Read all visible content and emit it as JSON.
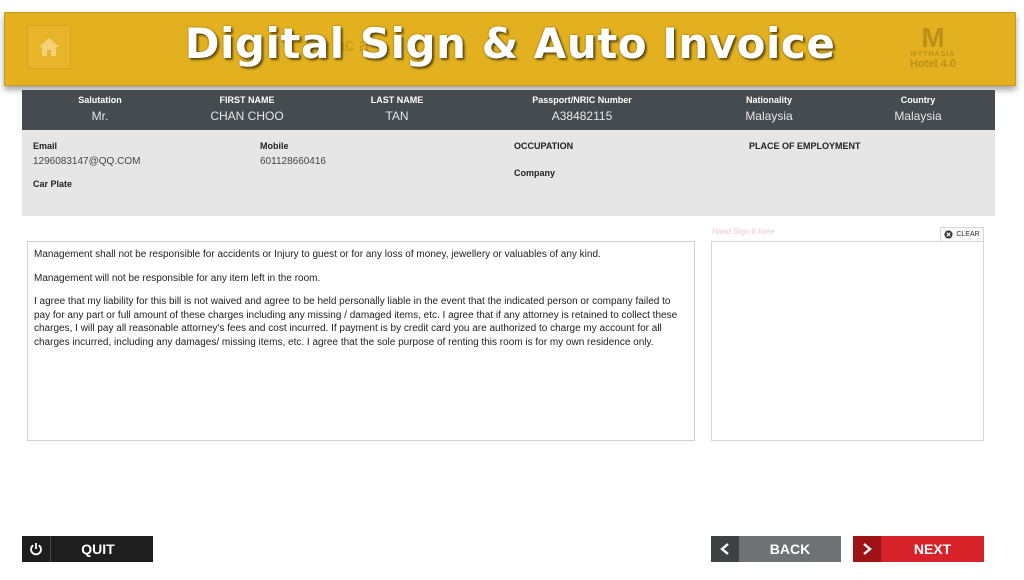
{
  "banner": {
    "title": "Digital Sign & Auto Invoice",
    "behind_text": "the      ac                     a",
    "logo_mark": "M",
    "logo_line1": "MYTHASIA",
    "logo_line2": "Hotel 4.0"
  },
  "guest": {
    "salutation_label": "Salutation",
    "salutation": "Mr.",
    "first_name_label": "FIRST NAME",
    "first_name": "CHAN CHOO",
    "last_name_label": "LAST NAME",
    "last_name": "TAN",
    "passport_label": "Passport/NRIC Number",
    "passport": "A38482115",
    "nationality_label": "Nationality",
    "nationality": "Malaysia",
    "country_label": "Country",
    "country": "Malaysia"
  },
  "details": {
    "email_label": "Email",
    "email": "1296083147@QQ.COM",
    "mobile_label": "Mobile",
    "mobile": "601128660416",
    "occupation_label": "OCCUPATION",
    "employment_label": "PLACE OF EMPLOYMENT",
    "car_plate_label": "Car Plate",
    "company_label": "Company"
  },
  "terms": [
    "Management shall not be responsible for accidents or Injury to guest or for any loss of money, jewellery or valuables of any kind.",
    "Management will not be responsible for any item left in the room.",
    "I agree that my liability for this bill is not waived and agree to be held personally liable in the event that the indicated person or company failed to pay for any part or full amount of these charges including any missing / damaged items, etc. I agree that if any attorney is retained to collect these charges, I will pay all reasonable attorney's fees and cost incurred. If payment is by credit card you are authorized to charge my account for all charges incurred, including any damages/ missing items, etc. I agree that the sole purpose of renting this room is for my own residence only."
  ],
  "signature": {
    "hint": "Hand Sign It here",
    "clear_label": "CLEAR"
  },
  "buttons": {
    "quit": "QUIT",
    "back": "BACK",
    "next": "NEXT"
  },
  "colors": {
    "banner": "#e3b11f",
    "info_bar": "#464b50",
    "next": "#d8222a",
    "back": "#6f7275"
  }
}
